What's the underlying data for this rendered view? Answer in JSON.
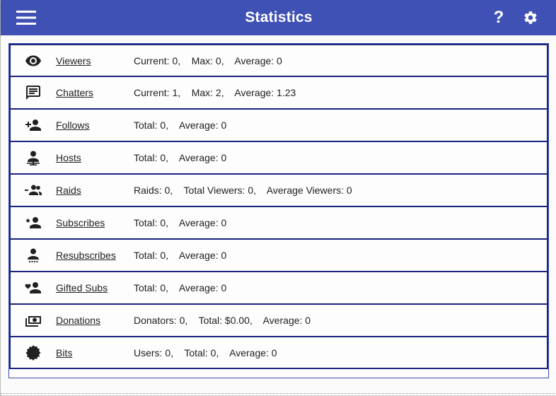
{
  "appbar": {
    "title": "Statistics",
    "menu_icon": "hamburger-menu-icon",
    "help_label": "?",
    "settings_icon": "gear-icon",
    "color": "#3f51b5"
  },
  "stats": [
    {
      "icon": "eye-icon",
      "label": "Viewers",
      "values": "Current: 0,    Max: 0,    Average: 0"
    },
    {
      "icon": "chat-icon",
      "label": "Chatters",
      "values": "Current: 1,    Max: 2,    Average: 1.23"
    },
    {
      "icon": "person-add-icon",
      "label": "Follows",
      "values": "Total: 0,    Average: 0"
    },
    {
      "icon": "host-icon",
      "label": "Hosts",
      "values": "Total: 0,    Average: 0"
    },
    {
      "icon": "raid-icon",
      "label": "Raids",
      "values": "Raids: 0,    Total Viewers: 0,    Average Viewers: 0"
    },
    {
      "icon": "subscribe-icon",
      "label": "Subscribes",
      "values": "Total: 0,    Average: 0"
    },
    {
      "icon": "resubscribe-icon",
      "label": "Resubscribes",
      "values": "Total: 0,    Average: 0"
    },
    {
      "icon": "gifted-sub-icon",
      "label": "Gifted Subs",
      "values": "Total: 0,    Average: 0"
    },
    {
      "icon": "money-icon",
      "label": "Donations",
      "values": "Donators: 0,    Total: $0.00,    Average: 0"
    },
    {
      "icon": "bits-icon",
      "label": "Bits",
      "values": "Users: 0,    Total: 0,    Average: 0"
    }
  ]
}
